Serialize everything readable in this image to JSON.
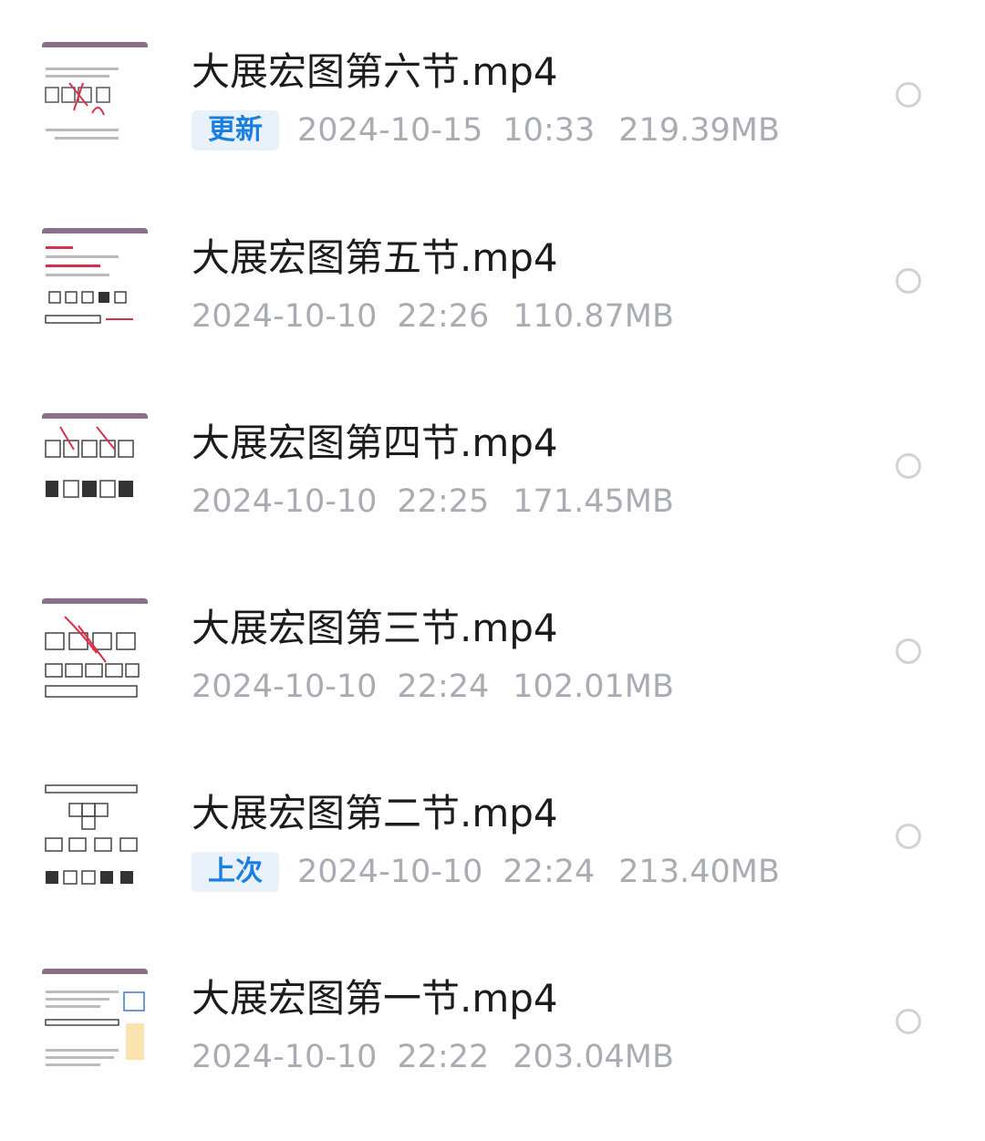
{
  "files": [
    {
      "name": "大展宏图第六节.mp4",
      "badge": "更新",
      "date": "2024-10-15",
      "time": "10:33",
      "size": "219.39MB"
    },
    {
      "name": "大展宏图第五节.mp4",
      "badge": "",
      "date": "2024-10-10",
      "time": "22:26",
      "size": "110.87MB"
    },
    {
      "name": "大展宏图第四节.mp4",
      "badge": "",
      "date": "2024-10-10",
      "time": "22:25",
      "size": "171.45MB"
    },
    {
      "name": "大展宏图第三节.mp4",
      "badge": "",
      "date": "2024-10-10",
      "time": "22:24",
      "size": "102.01MB"
    },
    {
      "name": "大展宏图第二节.mp4",
      "badge": "上次",
      "date": "2024-10-10",
      "time": "22:24",
      "size": "213.40MB"
    },
    {
      "name": "大展宏图第一节.mp4",
      "badge": "",
      "date": "2024-10-10",
      "time": "22:22",
      "size": "203.04MB"
    }
  ],
  "colors": {
    "badge_text": "#1a7fe0",
    "badge_bg": "#e9f1fb",
    "meta_text": "#a9adb3",
    "title_text": "#1c1c1e"
  },
  "icons": {
    "thumbnail": "video-thumbnail",
    "select": "radio-circle-icon"
  }
}
